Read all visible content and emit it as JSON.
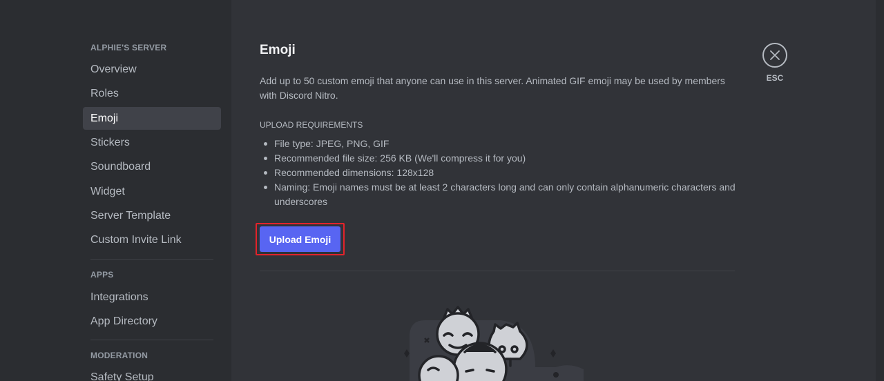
{
  "sidebar": {
    "server_header": "ALPHIE'S SERVER",
    "server_items": [
      {
        "label": "Overview"
      },
      {
        "label": "Roles"
      },
      {
        "label": "Emoji"
      },
      {
        "label": "Stickers"
      },
      {
        "label": "Soundboard"
      },
      {
        "label": "Widget"
      },
      {
        "label": "Server Template"
      },
      {
        "label": "Custom Invite Link"
      }
    ],
    "apps_header": "APPS",
    "apps_items": [
      {
        "label": "Integrations"
      },
      {
        "label": "App Directory"
      }
    ],
    "moderation_header": "MODERATION",
    "moderation_items": [
      {
        "label": "Safety Setup"
      }
    ],
    "active_item": "Emoji"
  },
  "main": {
    "title": "Emoji",
    "description": "Add up to 50 custom emoji that anyone can use in this server. Animated GIF emoji may be used by members with Discord Nitro.",
    "requirements_header": "UPLOAD REQUIREMENTS",
    "requirements": [
      "File type: JPEG, PNG, GIF",
      "Recommended file size: 256 KB (We'll compress it for you)",
      "Recommended dimensions: 128x128",
      "Naming: Emoji names must be at least 2 characters long and can only contain alphanumeric characters and underscores"
    ],
    "upload_button_label": "Upload Emoji"
  },
  "close": {
    "icon": "close-icon",
    "label": "ESC"
  },
  "colors": {
    "background": "#313338",
    "sidebar": "#2b2d31",
    "active_item": "#404249",
    "accent": "#5865f2",
    "highlight": "#e3232b"
  }
}
